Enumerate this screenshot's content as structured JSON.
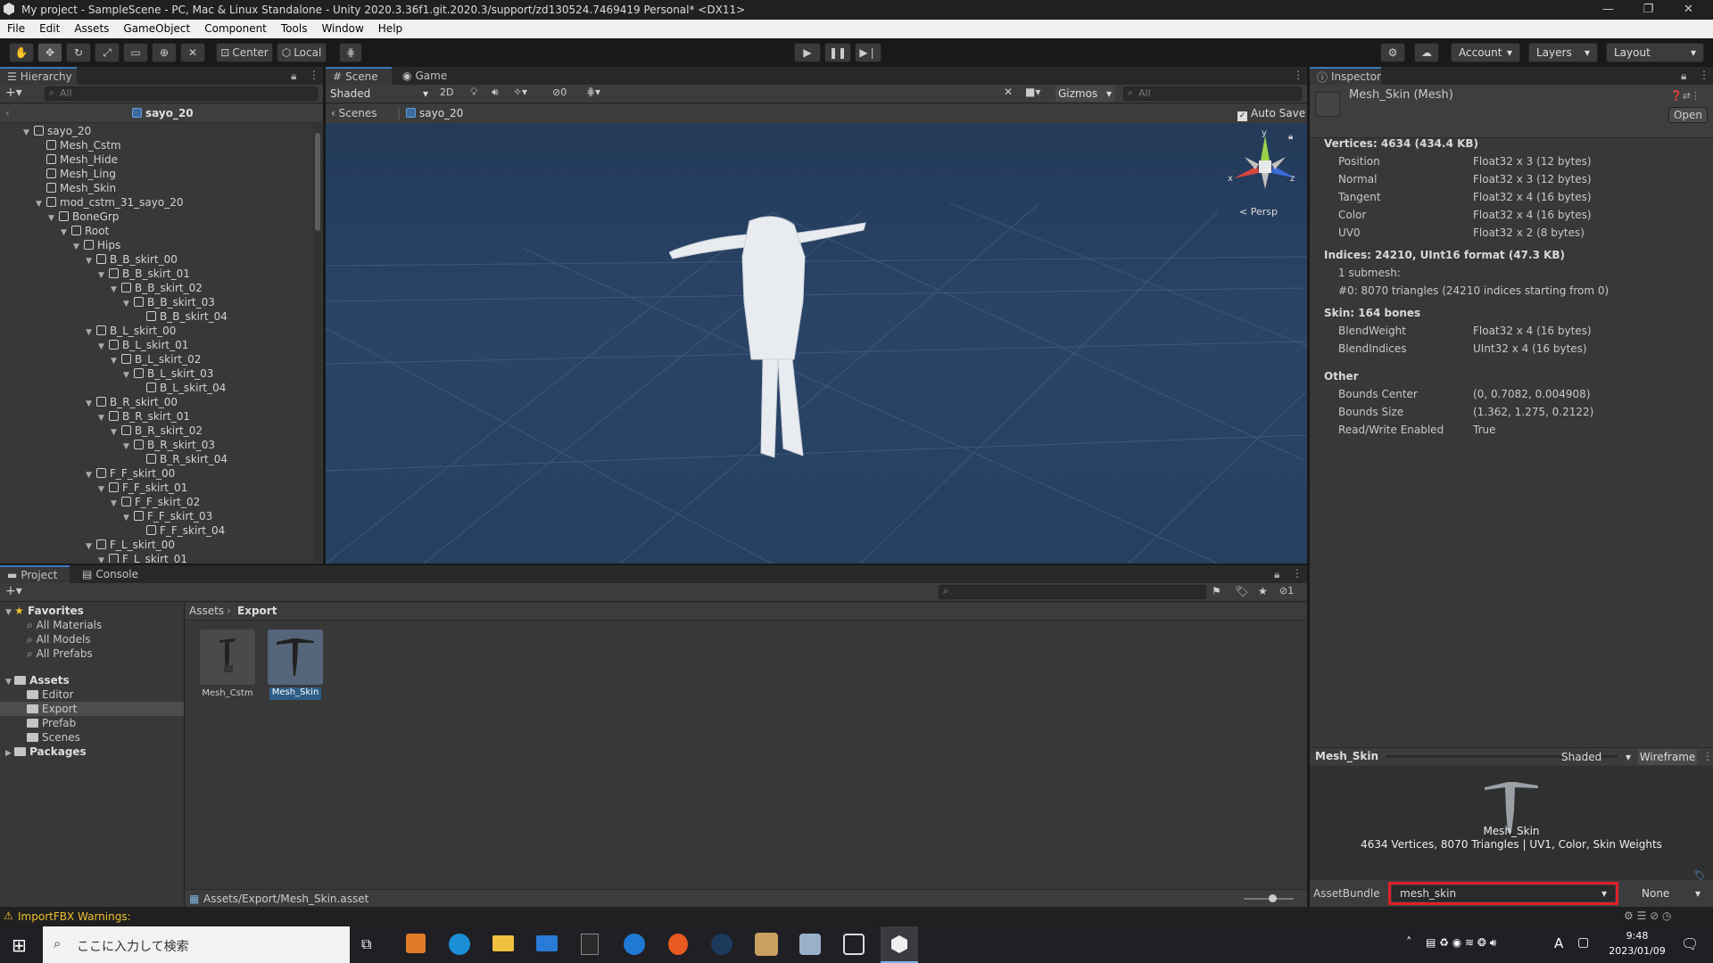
{
  "window": {
    "title": "My project - SampleScene - PC, Mac & Linux Standalone - Unity 2020.3.36f1.git.2020.3/support/zd130524.7469419 Personal* <DX11>"
  },
  "menu": [
    "File",
    "Edit",
    "Assets",
    "GameObject",
    "Component",
    "Tools",
    "Window",
    "Help"
  ],
  "toolbar": {
    "pivot_center": "Center",
    "pivot_local": "Local",
    "account": "Account",
    "layers": "Layers",
    "layout": "Layout"
  },
  "hierarchy": {
    "tab": "Hierarchy",
    "search_placeholder": "All",
    "scene_name": "sayo_20",
    "items": [
      {
        "label": "sayo_20",
        "depth": 0,
        "arrow": "▼"
      },
      {
        "label": "Mesh_Cstm",
        "depth": 1,
        "arrow": ""
      },
      {
        "label": "Mesh_Hide",
        "depth": 1,
        "arrow": ""
      },
      {
        "label": "Mesh_Ling",
        "depth": 1,
        "arrow": ""
      },
      {
        "label": "Mesh_Skin",
        "depth": 1,
        "arrow": ""
      },
      {
        "label": "mod_cstm_31_sayo_20",
        "depth": 1,
        "arrow": "▼"
      },
      {
        "label": "BoneGrp",
        "depth": 2,
        "arrow": "▼"
      },
      {
        "label": "Root",
        "depth": 3,
        "arrow": "▼"
      },
      {
        "label": "Hips",
        "depth": 4,
        "arrow": "▼"
      },
      {
        "label": "B_B_skirt_00",
        "depth": 5,
        "arrow": "▼"
      },
      {
        "label": "B_B_skirt_01",
        "depth": 6,
        "arrow": "▼"
      },
      {
        "label": "B_B_skirt_02",
        "depth": 7,
        "arrow": "▼"
      },
      {
        "label": "B_B_skirt_03",
        "depth": 8,
        "arrow": "▼"
      },
      {
        "label": "B_B_skirt_04",
        "depth": 9,
        "arrow": ""
      },
      {
        "label": "B_L_skirt_00",
        "depth": 5,
        "arrow": "▼"
      },
      {
        "label": "B_L_skirt_01",
        "depth": 6,
        "arrow": "▼"
      },
      {
        "label": "B_L_skirt_02",
        "depth": 7,
        "arrow": "▼"
      },
      {
        "label": "B_L_skirt_03",
        "depth": 8,
        "arrow": "▼"
      },
      {
        "label": "B_L_skirt_04",
        "depth": 9,
        "arrow": ""
      },
      {
        "label": "B_R_skirt_00",
        "depth": 5,
        "arrow": "▼"
      },
      {
        "label": "B_R_skirt_01",
        "depth": 6,
        "arrow": "▼"
      },
      {
        "label": "B_R_skirt_02",
        "depth": 7,
        "arrow": "▼"
      },
      {
        "label": "B_R_skirt_03",
        "depth": 8,
        "arrow": "▼"
      },
      {
        "label": "B_R_skirt_04",
        "depth": 9,
        "arrow": ""
      },
      {
        "label": "F_F_skirt_00",
        "depth": 5,
        "arrow": "▼"
      },
      {
        "label": "F_F_skirt_01",
        "depth": 6,
        "arrow": "▼"
      },
      {
        "label": "F_F_skirt_02",
        "depth": 7,
        "arrow": "▼"
      },
      {
        "label": "F_F_skirt_03",
        "depth": 8,
        "arrow": "▼"
      },
      {
        "label": "F_F_skirt_04",
        "depth": 9,
        "arrow": ""
      },
      {
        "label": "F_L_skirt_00",
        "depth": 5,
        "arrow": "▼"
      },
      {
        "label": "F_L_skirt_01",
        "depth": 6,
        "arrow": "▼"
      }
    ]
  },
  "scene": {
    "tab_scene": "Scene",
    "tab_game": "Game",
    "shading": "Shaded",
    "mode_2d": "2D",
    "hidden_count": "0",
    "gizmos": "Gizmos",
    "search_placeholder": "All",
    "breadcrumb_scenes": "Scenes",
    "breadcrumb_prefab": "sayo_20",
    "auto_save": "Auto Save",
    "persp": "< Persp",
    "axis_y": "y",
    "axis_x": "x",
    "axis_z": "z"
  },
  "inspector": {
    "tab": "Inspector",
    "object": "Mesh_Skin (Mesh)",
    "open": "Open",
    "vertices_header": "Vertices: 4634 (434.4 KB)",
    "vertex_attrs": [
      {
        "k": "Position",
        "v": "Float32 x 3 (12 bytes)"
      },
      {
        "k": "Normal",
        "v": "Float32 x 3 (12 bytes)"
      },
      {
        "k": "Tangent",
        "v": "Float32 x 4 (16 bytes)"
      },
      {
        "k": "Color",
        "v": "Float32 x 4 (16 bytes)"
      },
      {
        "k": "UV0",
        "v": "Float32 x 2 (8 bytes)"
      }
    ],
    "indices_header": "Indices: 24210, UInt16 format (47.3 KB)",
    "submesh_count": "1 submesh:",
    "submesh_0": "#0: 8070 triangles (24210 indices starting from 0)",
    "skin_header": "Skin: 164 bones",
    "skin_attrs": [
      {
        "k": "BlendWeight",
        "v": "Float32 x 4 (16 bytes)"
      },
      {
        "k": "BlendIndices",
        "v": "UInt32 x 4 (16 bytes)"
      }
    ],
    "other_header": "Other",
    "other_attrs": [
      {
        "k": "Bounds Center",
        "v": "(0, 0.7082, 0.004908)"
      },
      {
        "k": "Bounds Size",
        "v": "(1.362, 1.275, 0.2122)"
      },
      {
        "k": "Read/Write Enabled",
        "v": "True"
      }
    ],
    "preview_title": "Mesh_Skin",
    "preview_shading": "Shaded",
    "preview_wireframe": "Wireframe",
    "preview_name": "Mesh_Skin",
    "preview_stats": "4634 Vertices, 8070 Triangles | UV1, Color, Skin Weights",
    "assetbundle_label": "AssetBundle",
    "assetbundle_value": "mesh_skin",
    "assetbundle_variant": "None"
  },
  "project": {
    "tab_project": "Project",
    "tab_console": "Console",
    "hidden_count": "1",
    "favorites": "Favorites",
    "fav_items": [
      "All Materials",
      "All Models",
      "All Prefabs"
    ],
    "assets": "Assets",
    "asset_folders": [
      "Editor",
      "Export",
      "Prefab",
      "Scenes"
    ],
    "packages": "Packages",
    "breadcrumb": [
      "Assets",
      "Export"
    ],
    "files": [
      {
        "name": "Mesh_Cstm",
        "selected": false
      },
      {
        "name": "Mesh_Skin",
        "selected": true
      }
    ],
    "selected_path": "Assets/Export/Mesh_Skin.asset"
  },
  "status": {
    "warning": "ImportFBX Warnings:"
  },
  "taskbar": {
    "search_placeholder": "ここに入力して検索",
    "time": "9:48",
    "date": "2023/01/09",
    "ime": "A"
  }
}
